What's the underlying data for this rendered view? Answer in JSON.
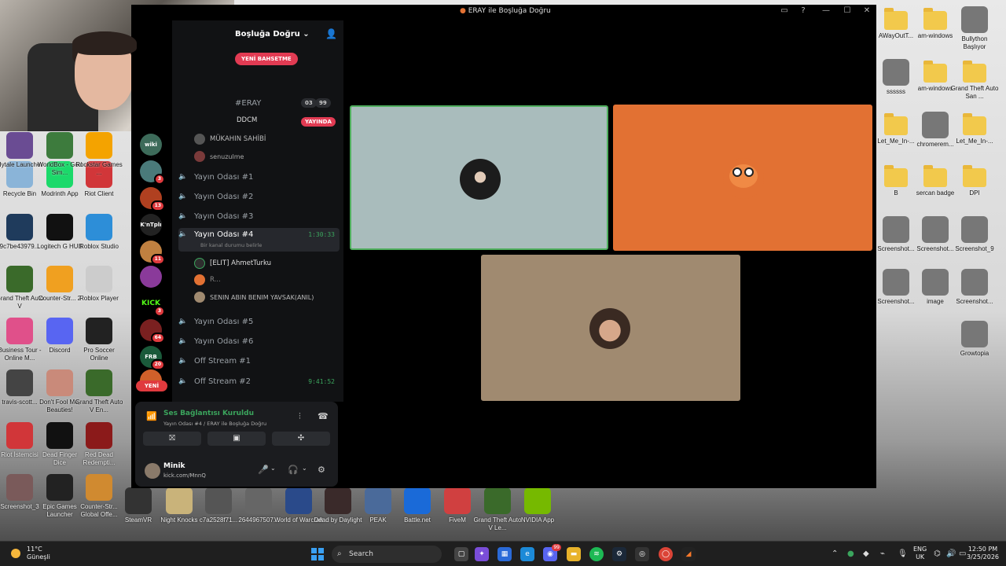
{
  "window": {
    "title": "ERAY ile Boşluğa Doğru"
  },
  "server": {
    "name": "Boşluğa Doğru",
    "new_mention_label": "YENİ BAHSETME",
    "new_label": "YENİ"
  },
  "channels": {
    "top_channel": "#ERAY",
    "top_channel_counts": [
      "03",
      "99"
    ],
    "live_user": "DDCM",
    "live_tag": "YAYINDA",
    "owner_user": "MÜKAHIN SAHİBİ",
    "owner_sub": "senuzulme",
    "voice": [
      {
        "name": "Yayın Odası #1"
      },
      {
        "name": "Yayın Odası #2"
      },
      {
        "name": "Yayın Odası #3"
      },
      {
        "name": "Yayın Odası #4",
        "time": "1:30:33",
        "status": "Bir kanal durumu belirle"
      },
      {
        "name": "Yayın Odası #5"
      },
      {
        "name": "Yayın Odası #6"
      },
      {
        "name": "Off Stream #1"
      },
      {
        "name": "Off Stream #2",
        "time": "9:41:52"
      }
    ],
    "members": [
      "[ELIT] AhmetTurku",
      "R...",
      "SENIN ABIN BENIM YAVSAK(ANIL)"
    ]
  },
  "guild_badges": [
    "3",
    "13",
    "11",
    "3",
    "64",
    "20"
  ],
  "voice_panel": {
    "status": "Ses Bağlantısı Kuruldu",
    "channel": "Yayın Odası #4 / ERAY ile Boşluğa Doğru",
    "user_name": "Minik",
    "user_status": "kick.com/MnnQ"
  },
  "desktop_left": [
    {
      "label": "Hytale Launcher",
      "color": "#6a4c93"
    },
    {
      "label": "WorldBox - God Sim...",
      "color": "#3d7b3d"
    },
    {
      "label": "Rockstar Games ...",
      "color": "#f4a300"
    },
    {
      "label": "Recycle Bin",
      "color": "#8ab4d8"
    },
    {
      "label": "Modrinth App",
      "color": "#1bd96a"
    },
    {
      "label": "Riot Client",
      "color": "#d13639"
    },
    {
      "label": "9c7be43979...",
      "color": "#1f3b5c"
    },
    {
      "label": "Logitech G HUB",
      "color": "#111111"
    },
    {
      "label": "Roblox Studio",
      "color": "#2d8ed8"
    },
    {
      "label": "Grand Theft Auto V",
      "color": "#3a6a2a"
    },
    {
      "label": "Counter-Str... 2",
      "color": "#f0a020"
    },
    {
      "label": "Roblox Player",
      "color": "#cccccc"
    },
    {
      "label": "Business Tour - Online M...",
      "color": "#e0508a"
    },
    {
      "label": "Discord",
      "color": "#5865f2"
    },
    {
      "label": "Pro Soccer Online",
      "color": "#222222"
    },
    {
      "label": "travis-scott...",
      "color": "#444444"
    },
    {
      "label": "Don't Fool Me, Beauties!",
      "color": "#c98a7a"
    },
    {
      "label": "Grand Theft Auto V En...",
      "color": "#3a6a2a"
    },
    {
      "label": "Riot İstemcisi",
      "color": "#d13639"
    },
    {
      "label": "Dead Finger Dice",
      "color": "#111111"
    },
    {
      "label": "Red Dead Redempti...",
      "color": "#8b1a1a"
    },
    {
      "label": "Screenshot_3",
      "color": "#7a5a5a"
    },
    {
      "label": "Epic Games Launcher",
      "color": "#222222"
    },
    {
      "label": "Counter-Str... Global Offe...",
      "color": "#d08a30"
    }
  ],
  "desktop_bottom": [
    {
      "label": "SteamVR"
    },
    {
      "label": "Night Knocks"
    },
    {
      "label": "c7a2528f71..."
    },
    {
      "label": "2644967507..."
    },
    {
      "label": "World of Warcraft"
    },
    {
      "label": "Dead by Daylight"
    },
    {
      "label": "PEAK"
    },
    {
      "label": "Battle.net"
    },
    {
      "label": "FiveM"
    },
    {
      "label": "Grand Theft Auto V Le..."
    },
    {
      "label": "NVIDIA App"
    }
  ],
  "desktop_right": [
    {
      "label": "AWayOutT...",
      "kind": "folder"
    },
    {
      "label": "am-windows",
      "kind": "folder"
    },
    {
      "label": "Bullython Başlıyor",
      "kind": "img"
    },
    {
      "label": "ssssss",
      "kind": "img"
    },
    {
      "label": "am-windows",
      "kind": "folder"
    },
    {
      "label": "Grand Theft Auto San ...",
      "kind": "folder"
    },
    {
      "label": "Let_Me_In-...",
      "kind": "folder"
    },
    {
      "label": "chromerem...",
      "kind": "img"
    },
    {
      "label": "Let_Me_In-...",
      "kind": "folder"
    },
    {
      "label": "B",
      "kind": "folder"
    },
    {
      "label": "sercan badge",
      "kind": "folder"
    },
    {
      "label": "DPI",
      "kind": "folder"
    },
    {
      "label": "Screenshot...",
      "kind": "img"
    },
    {
      "label": "Screenshot...",
      "kind": "img"
    },
    {
      "label": "Screenshot_9",
      "kind": "img"
    },
    {
      "label": "Screenshot...",
      "kind": "img"
    },
    {
      "label": "image",
      "kind": "img"
    },
    {
      "label": "Screenshot...",
      "kind": "img"
    },
    {
      "label": "Growtopia",
      "kind": "img"
    }
  ],
  "taskbar": {
    "temp": "11°C",
    "weather": "Güneşli",
    "search": "Search",
    "lang_top": "ENG",
    "lang_bottom": "UK",
    "time": "12:50 PM",
    "date": "3/25/2026",
    "discord_badge": "99"
  },
  "colors": {
    "tile1": "#a9bcbc",
    "tile2": "#e27133",
    "tile3": "#a08a70",
    "speaking_border": "#4fae5d"
  }
}
